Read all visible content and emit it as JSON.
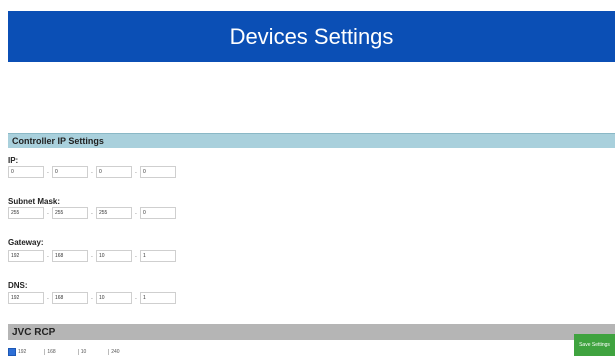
{
  "header": {
    "title": "Devices Settings"
  },
  "controller": {
    "title": "Controller IP Settings",
    "ip": {
      "label": "IP:",
      "octets": [
        "0",
        "0",
        "0",
        "0"
      ]
    },
    "subnet": {
      "label": "Subnet Mask:",
      "octets": [
        "255",
        "255",
        "255",
        "0"
      ]
    },
    "gateway": {
      "label": "Gateway:",
      "octets": [
        "192",
        "168",
        "10",
        "1"
      ]
    },
    "dns": {
      "label": "DNS:",
      "octets": [
        "192",
        "168",
        "10",
        "1"
      ]
    }
  },
  "jvc": {
    "title": "JVC RCP",
    "checked": true,
    "octets": [
      "192",
      "168",
      "10",
      "240"
    ]
  },
  "save_button": {
    "label": "Save Settings"
  },
  "separator": "."
}
